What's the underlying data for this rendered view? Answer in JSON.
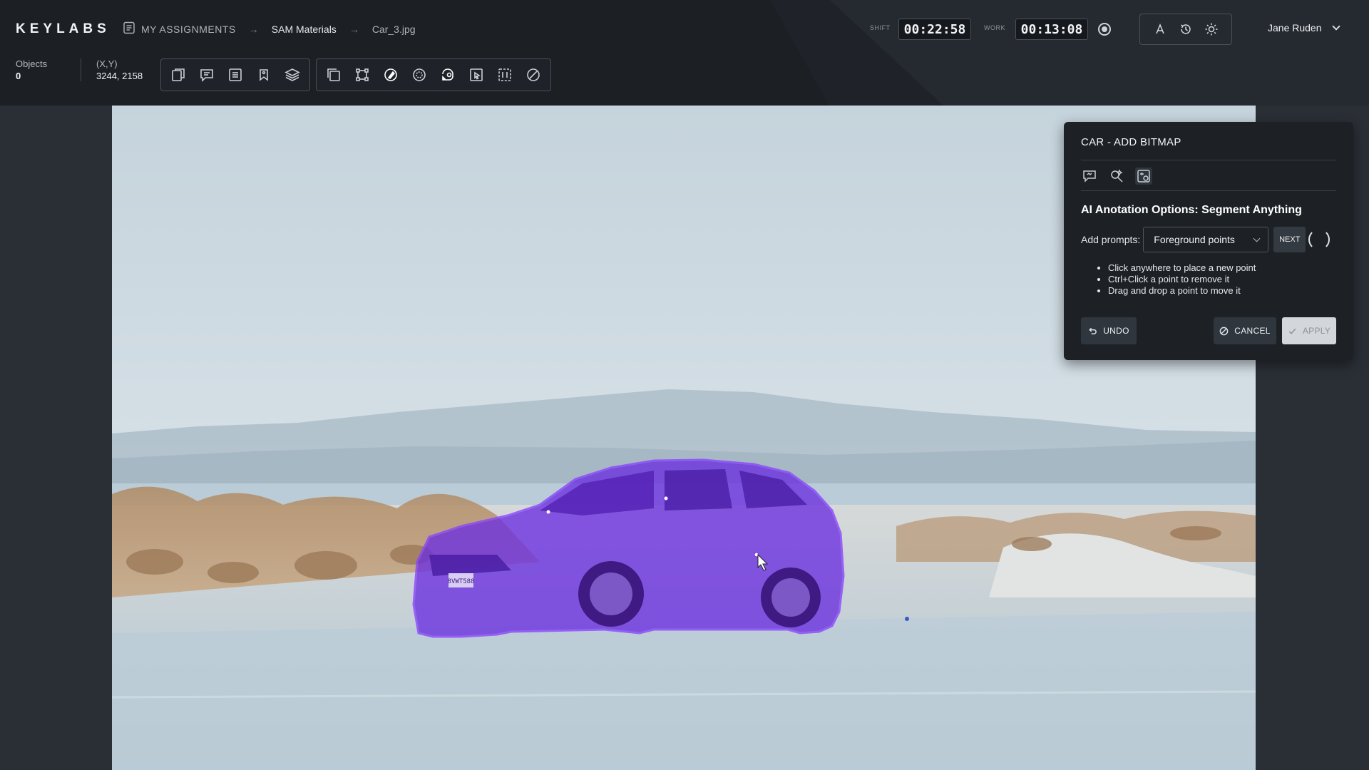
{
  "header": {
    "logo": "KEYLABS",
    "breadcrumb": [
      {
        "label": "MY ASSIGNMENTS",
        "icon": "assignments-icon"
      },
      {
        "label": "SAM Materials"
      },
      {
        "label": "Car_3.jpg"
      }
    ],
    "timers": {
      "shift_label": "SHIFT",
      "shift_value": "00:22:58",
      "work_label": "WORK",
      "work_value": "00:13:08"
    },
    "mode_icons": [
      "font-a-icon",
      "history-icon",
      "brightness-icon"
    ],
    "user_name": "Jane Ruden"
  },
  "toolbar": {
    "objects_label": "Objects",
    "objects_value": "0",
    "coords_label": "(X,Y)",
    "coords_value": "3244, 2158",
    "group1": [
      "new-layer-icon",
      "comment-icon",
      "list-icon",
      "tag-icon",
      "layers-icon"
    ],
    "group2": [
      "bounding-box-icon",
      "polygon-icon",
      "brush-icon",
      "magic-select-icon",
      "segment-anything-icon",
      "cursor-box-icon",
      "dashed-box-icon",
      "no-entry-icon"
    ],
    "active_tool": "brush-icon"
  },
  "panel": {
    "title": "CAR - ADD BITMAP",
    "tabs": [
      "ai-chat-icon",
      "magic-wand-icon",
      "ai-settings-icon"
    ],
    "heading": "AI Anotation Options: Segment Anything",
    "prompt_label": "Add prompts:",
    "prompt_selected": "Foreground points",
    "next_label": "NEXT",
    "tips": [
      "Click anywhere to place a new point",
      "Ctrl+Click a point to remove it",
      "Drag and drop a point to move it"
    ],
    "undo_label": "UNDO",
    "cancel_label": "CANCEL",
    "apply_label": "APPLY"
  },
  "canvas": {
    "license_plate": "8VWT588",
    "mask_color": "#7a2df0"
  }
}
